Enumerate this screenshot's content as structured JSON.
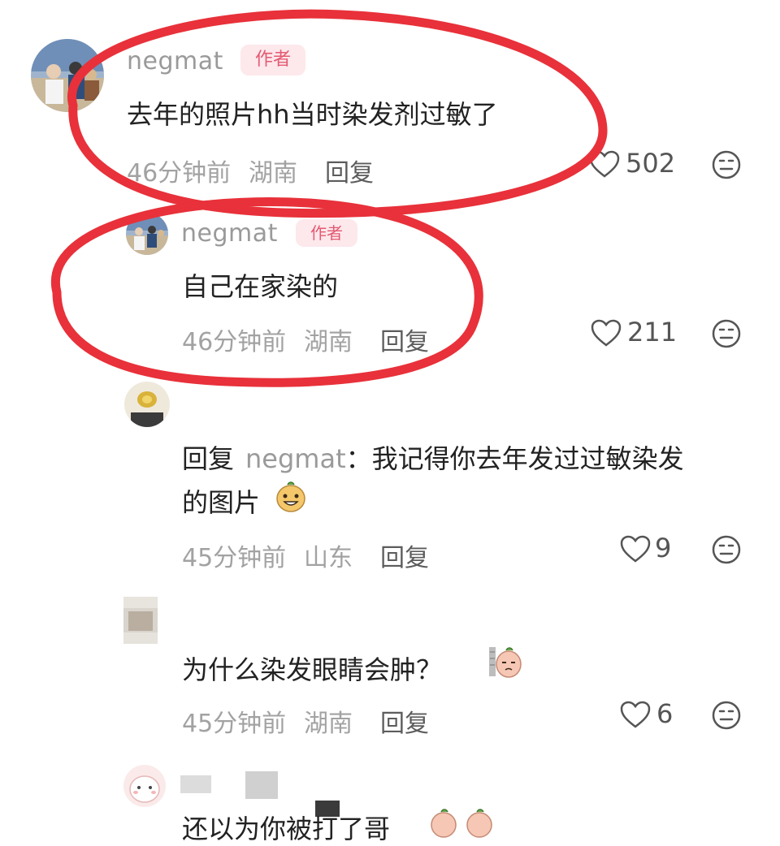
{
  "comments": [
    {
      "username": "negmat",
      "badge": "作者",
      "text": "去年的照片hh当时染发剂过敏了",
      "time": "46分钟前",
      "location": "湖南",
      "reply_label": "回复",
      "likes": "502",
      "avatar_icon": "user-avatar-photo"
    },
    {
      "username": "negmat",
      "badge": "作者",
      "text": "自己在家染的",
      "time": "46分钟前",
      "location": "湖南",
      "reply_label": "回复",
      "likes": "211",
      "avatar_icon": "user-avatar-photo"
    },
    {
      "reply_prefix": "回复",
      "reply_to": "negmat",
      "reply_colon": "：",
      "text_line1": "我记得你去年发过过敏染发",
      "text_line2": "的图片",
      "emoji_icon": "peanut-grin-emoji",
      "time": "45分钟前",
      "location": "山东",
      "reply_label": "回复",
      "likes": "9",
      "avatar_icon": "user-avatar-food"
    },
    {
      "text": "为什么染发眼睛会肿？",
      "emoji_icon": "peanut-sad-emoji",
      "time": "45分钟前",
      "location": "湖南",
      "reply_label": "回复",
      "likes": "6",
      "avatar_icon": "user-avatar-blurred"
    },
    {
      "text": "还以为你被打了哥",
      "emoji_icon": "peanut-shy-emoji",
      "avatar_icon": "user-avatar-cartoon"
    }
  ],
  "colors": {
    "annotation_red": "#e8313a",
    "author_badge_bg": "#fde8ec",
    "author_badge_text": "#e35a72",
    "meta_gray": "#a2a2a2",
    "text_dark": "#222222"
  }
}
